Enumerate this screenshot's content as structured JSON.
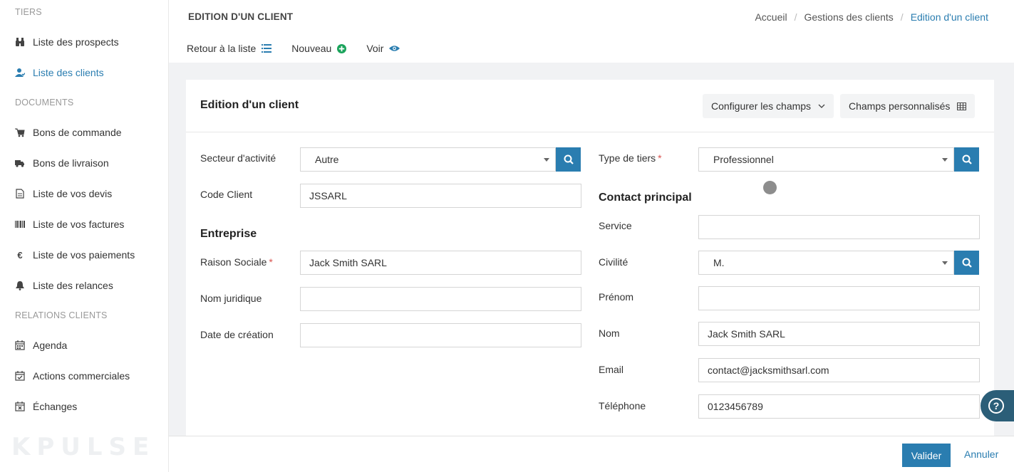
{
  "sidebar": {
    "sections": [
      "TIERS",
      "DOCUMENTS",
      "RELATIONS CLIENTS"
    ],
    "items": [
      {
        "label": "Liste des prospects",
        "icon": "binoculars-icon"
      },
      {
        "label": "Liste des clients",
        "icon": "user-icon",
        "active": true
      },
      {
        "label": "Bons de commande",
        "icon": "cart-icon"
      },
      {
        "label": "Bons de livraison",
        "icon": "truck-icon"
      },
      {
        "label": "Liste de vos devis",
        "icon": "document-icon"
      },
      {
        "label": "Liste de vos factures",
        "icon": "barcode-icon"
      },
      {
        "label": "Liste de vos paiements",
        "icon": "euro-icon"
      },
      {
        "label": "Liste des relances",
        "icon": "bell-icon"
      },
      {
        "label": "Agenda",
        "icon": "calendar-icon"
      },
      {
        "label": "Actions commerciales",
        "icon": "calendar-check-icon"
      },
      {
        "label": "Échanges",
        "icon": "calendar-x-icon"
      }
    ],
    "logo": "KPULSE"
  },
  "header": {
    "title": "EDITION D'UN CLIENT",
    "breadcrumb": [
      "Accueil",
      "Gestions des clients",
      "Edition d'un client"
    ],
    "actions": {
      "back": "Retour à la liste",
      "new": "Nouveau",
      "view": "Voir"
    }
  },
  "card": {
    "title": "Edition d'un client",
    "configure_label": "Configurer les champs",
    "custom_fields_label": "Champs personnalisés"
  },
  "form": {
    "secteur": {
      "label": "Secteur d'activité",
      "value": "Autre"
    },
    "code_client": {
      "label": "Code Client",
      "value": "JSSARL"
    },
    "entreprise_title": "Entreprise",
    "raison_sociale": {
      "label": "Raison Sociale",
      "required": "*",
      "value": "Jack Smith SARL"
    },
    "nom_juridique": {
      "label": "Nom juridique",
      "value": ""
    },
    "date_creation": {
      "label": "Date de création",
      "value": ""
    },
    "type_tiers": {
      "label": "Type de tiers",
      "required": "*",
      "value": "Professionnel"
    },
    "contact_title": "Contact principal",
    "service": {
      "label": "Service",
      "value": ""
    },
    "civilite": {
      "label": "Civilité",
      "value": "M."
    },
    "prenom": {
      "label": "Prénom",
      "value": ""
    },
    "nom": {
      "label": "Nom",
      "value": "Jack Smith SARL"
    },
    "email": {
      "label": "Email",
      "value": "contact@jacksmithsarl.com"
    },
    "telephone": {
      "label": "Téléphone",
      "value": "0123456789"
    }
  },
  "footer": {
    "validate": "Valider",
    "cancel": "Annuler"
  },
  "help": "?",
  "colors": {
    "accent": "#2a7db0",
    "help_bg": "#2b5e78",
    "required": "#d9534f"
  }
}
